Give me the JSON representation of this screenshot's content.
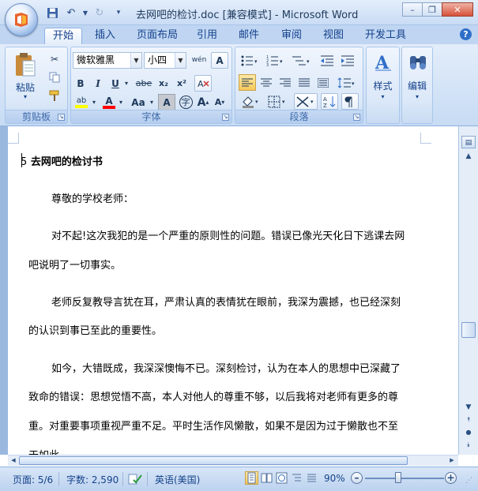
{
  "window": {
    "title": "去网吧的检讨.doc [兼容模式] - Microsoft Word"
  },
  "tabs": [
    "开始",
    "插入",
    "页面布局",
    "引用",
    "邮件",
    "审阅",
    "视图",
    "开发工具"
  ],
  "ribbon": {
    "clipboard": {
      "label": "剪贴板",
      "paste_label": "粘贴"
    },
    "font": {
      "label": "字体",
      "font_name": "微软雅黑",
      "font_size": "小四",
      "bold": "B",
      "italic": "I",
      "underline": "U",
      "strike": "abe",
      "subscript": "x₂",
      "superscript": "x²",
      "change_case": "Aa",
      "char_shading": "A",
      "enclose": "字",
      "grow": "A",
      "shrink": "A",
      "phonetic": "wén",
      "clear_format": "A",
      "font_color": "A",
      "highlight": "ab"
    },
    "paragraph": {
      "label": "段落"
    },
    "styles": {
      "label": "样式"
    },
    "editing": {
      "label": "编辑"
    }
  },
  "document": {
    "heading_prefix": "5",
    "heading": "去网吧的检讨书",
    "lines": [
      "尊敬的学校老师：",
      "对不起!这次我犯的是一个严重的原则性的问题。错误已像光天化日下逃课去网",
      "吧说明了一切事实。",
      "老师反复教导言犹在耳，严肃认真的表情犹在眼前，我深为震撼，也已经深刻",
      "的认识到事已至此的重要性。",
      "如今，大错既成，我深深懊悔不已。深刻检讨，认为在本人的思想中已深藏了",
      "致命的错误：思想觉悟不高，本人对他人的尊重不够，以后我将对老师有更多的尊",
      "重。对重要事项重视严重不足。平时生活作风懒散，如果不是因为过于懒散也不至",
      "于如此"
    ]
  },
  "status": {
    "page": "页面: 5/6",
    "words": "字数: 2,590",
    "language": "英语(美国)",
    "zoom": "90%"
  },
  "colors": {
    "accent": "#15428b",
    "ribbon_bg": "#d4e4f7",
    "font_color_bar": "#ff0000",
    "highlight_bar": "#ffff00"
  }
}
